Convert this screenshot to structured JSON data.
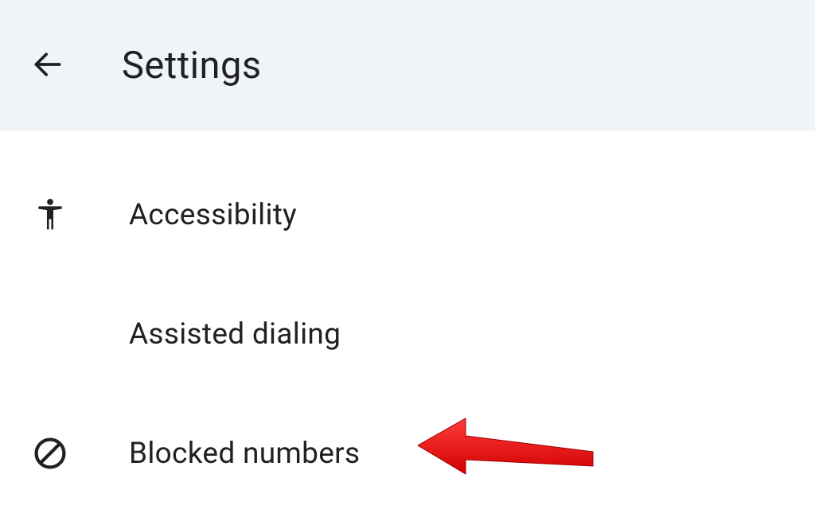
{
  "header": {
    "title": "Settings"
  },
  "list": {
    "items": [
      {
        "label": "Accessibility",
        "icon": "accessibility"
      },
      {
        "label": "Assisted dialing",
        "icon": ""
      },
      {
        "label": "Blocked numbers",
        "icon": "block"
      }
    ]
  },
  "annotation": {
    "arrow_color": "#ff0000"
  }
}
